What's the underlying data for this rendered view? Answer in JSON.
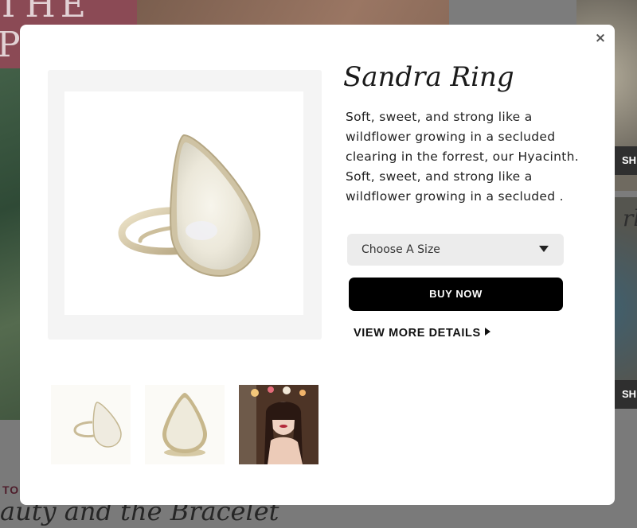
{
  "background": {
    "banner_text": "THE PALMS",
    "shop_label": "SH",
    "right_script_text": "rls",
    "section_label": "TO",
    "section_title": "auty and the Bracelet"
  },
  "modal": {
    "close_icon": "×",
    "product": {
      "title": "Sandra Ring",
      "description": "Soft, sweet, and strong like a wildflower growing in a secluded clearing in the forrest, our Hyacinth. Soft, sweet, and strong like a wildflower growing in a secluded ."
    },
    "size_select": {
      "selected": "Choose A Size"
    },
    "buy_label": "BUY NOW",
    "details_label": "VIEW MORE DETAILS",
    "icons": {
      "close": "close-icon",
      "dropdown": "caret-down-icon",
      "details": "triangle-right-icon"
    },
    "colors": {
      "accent": "#000000",
      "select_bg": "#ececec",
      "frame_bg": "#f4f4f4"
    }
  }
}
